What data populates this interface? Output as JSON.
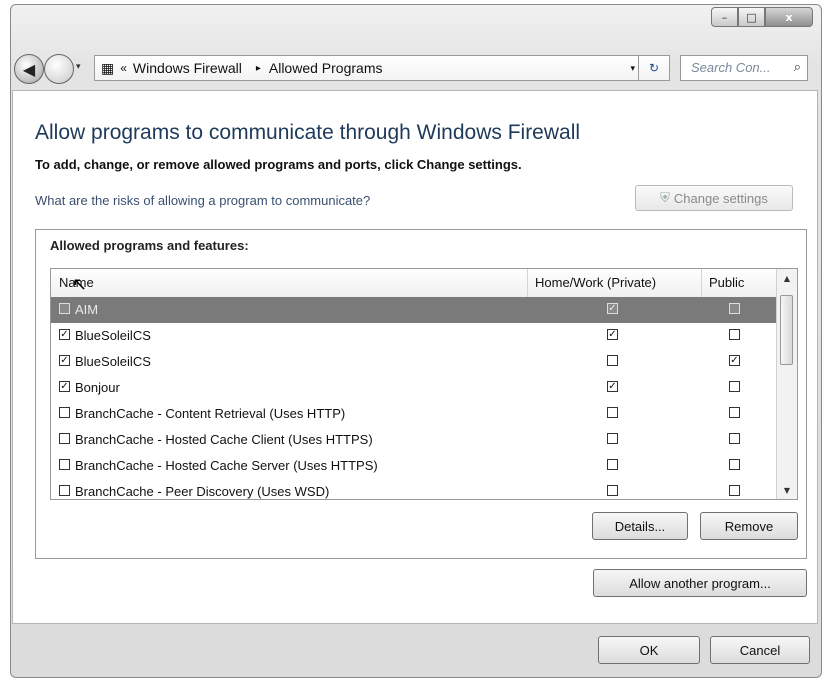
{
  "window": {
    "controls": {
      "minimize": "–",
      "maximize": "□",
      "close": "x"
    }
  },
  "nav": {
    "back_glyph": "◀",
    "breadcrumb_chevron": "«",
    "crumbs": [
      "Windows Firewall",
      "Allowed Programs"
    ],
    "crumb_separator": "▸",
    "dropdown_glyph": "▾",
    "refresh_glyph": "↻",
    "search_placeholder": "Search Con...",
    "search_icon": "⌕"
  },
  "main": {
    "title": "Allow programs to communicate through Windows Firewall",
    "subtitle": "To add, change, or remove allowed programs and ports, click Change settings.",
    "risks_link": "What are the risks of allowing a program to communicate?",
    "change_settings_label": "Change settings",
    "group_label": "Allowed programs and features:",
    "columns": {
      "name": "Name",
      "home": "Home/Work (Private)",
      "public": "Public"
    },
    "rows": [
      {
        "name": "AIM",
        "enabled": "",
        "home": "✓",
        "public": ""
      },
      {
        "name": "BlueSoleilCS",
        "enabled": "✓",
        "home": "✓",
        "public": ""
      },
      {
        "name": "BlueSoleilCS",
        "enabled": "✓",
        "home": "",
        "public": "✓"
      },
      {
        "name": "Bonjour",
        "enabled": "✓",
        "home": "✓",
        "public": ""
      },
      {
        "name": "BranchCache - Content Retrieval (Uses HTTP)",
        "enabled": "",
        "home": "",
        "public": ""
      },
      {
        "name": "BranchCache - Hosted Cache Client (Uses HTTPS)",
        "enabled": "",
        "home": "",
        "public": ""
      },
      {
        "name": "BranchCache - Hosted Cache Server (Uses HTTPS)",
        "enabled": "",
        "home": "",
        "public": ""
      },
      {
        "name": "BranchCache - Peer Discovery (Uses WSD)",
        "enabled": "",
        "home": "",
        "public": ""
      }
    ],
    "scroll_up": "▲",
    "scroll_down": "▼",
    "details_label": "Details...",
    "remove_label": "Remove",
    "allow_another_label": "Allow another program..."
  },
  "footer": {
    "ok_label": "OK",
    "cancel_label": "Cancel"
  }
}
